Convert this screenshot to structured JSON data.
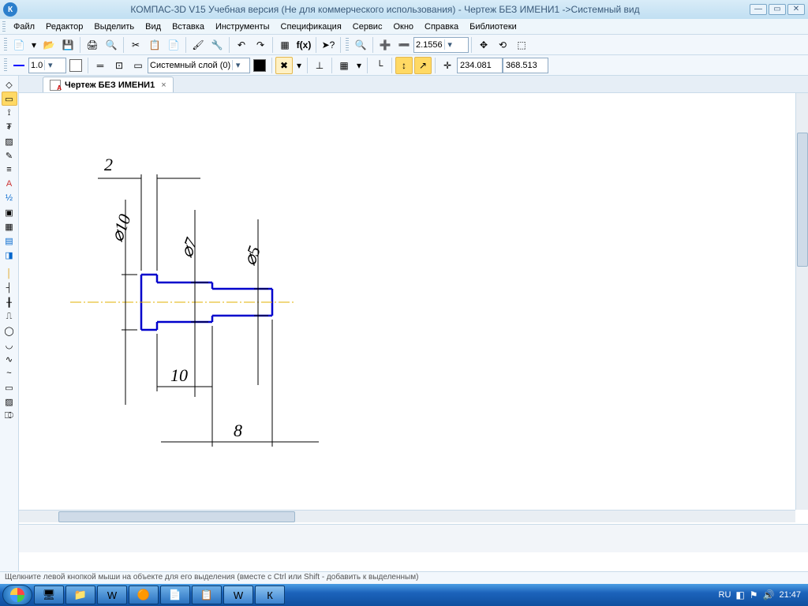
{
  "titlebar": {
    "app_icon_letter": "К",
    "title": "КОМПАС-3D V15 Учебная версия (Не для коммерческого использования) - Чертеж БЕЗ ИМЕНИ1 ->Системный вид"
  },
  "menu": {
    "items": [
      "Файл",
      "Редактор",
      "Выделить",
      "Вид",
      "Вставка",
      "Инструменты",
      "Спецификация",
      "Сервис",
      "Окно",
      "Справка",
      "Библиотеки"
    ]
  },
  "toolbar1": {
    "zoom_value": "2.1556"
  },
  "toolbar2": {
    "line_width": "1.0",
    "layer_label": "Системный слой (0)",
    "coord_x": "234.081",
    "coord_y": "368.513"
  },
  "document_tab": {
    "label": "Чертеж БЕЗ ИМЕНИ1"
  },
  "drawing": {
    "dims": {
      "len_2": "2",
      "len_10": "10",
      "len_8": "8",
      "dia_10": "⌀10",
      "dia_7": "⌀7",
      "dia_5": "⌀5"
    }
  },
  "status": {
    "hint": "Щелкните левой кнопкой мыши на объекте для его выделения (вместе с Ctrl или Shift - добавить к выделенным)"
  },
  "taskbar": {
    "lang": "RU",
    "clock": "21:47"
  }
}
